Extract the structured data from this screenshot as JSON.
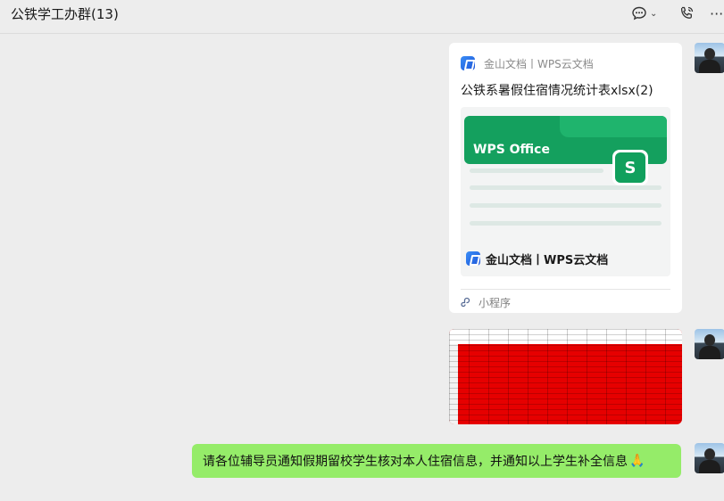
{
  "header": {
    "title": "公铁学工办群(13)",
    "chat_icon": "chat-bubble-icon",
    "call_icon": "phone-call-icon",
    "more_icon": "more-horizontal-icon",
    "chevron": "⌄",
    "more_glyph": "···"
  },
  "messages": [
    {
      "type": "mini_program",
      "source": "金山文档丨WPS云文档",
      "title": "公铁系暑假住宿情况统计表xlsx(2)",
      "preview_brand": "WPS Office",
      "tile_letter": "S",
      "preview_footer": "金山文档丨WPS云文档",
      "mini_label": "小程序"
    },
    {
      "type": "image",
      "description_icon": "spreadsheet-screenshot",
      "dominant_color": "#e60000"
    },
    {
      "type": "text",
      "text": "请各位辅导员通知假期留校学生核对本人住宿信息，并通知以上学生补全信息",
      "emoji": "🙏"
    }
  ],
  "colors": {
    "bubble_green": "#95ec69",
    "wps_green": "#14a05e",
    "background": "#ededed"
  }
}
